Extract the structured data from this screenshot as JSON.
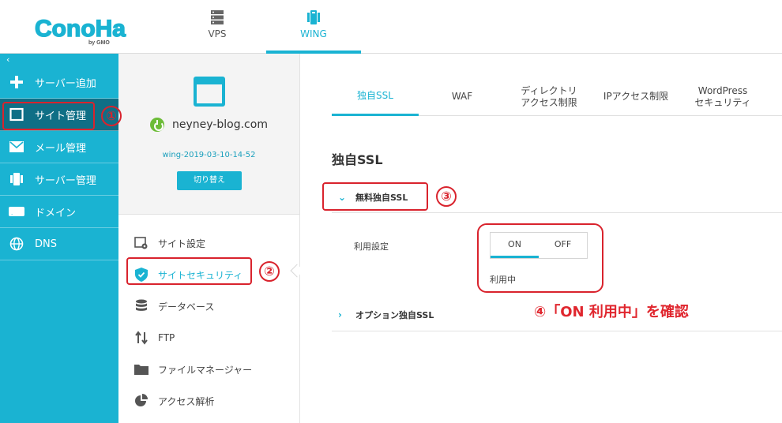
{
  "header": {
    "logo": {
      "text": "ConoHa",
      "sub": "by GMO"
    },
    "nav": [
      {
        "label": "VPS",
        "icon": "server-icon"
      },
      {
        "label": "WING",
        "icon": "wing-icon"
      }
    ]
  },
  "sidebar": {
    "collapse_icon": "chevron-left-icon",
    "items": [
      {
        "label": "サーバー追加",
        "icon": "plus-icon"
      },
      {
        "label": "サイト管理",
        "icon": "window-icon"
      },
      {
        "label": "メール管理",
        "icon": "mail-icon"
      },
      {
        "label": "サーバー管理",
        "icon": "server-manage-icon"
      },
      {
        "label": "ドメイン",
        "icon": "domain-icon"
      },
      {
        "label": "DNS",
        "icon": "globe-icon"
      }
    ]
  },
  "site": {
    "domain": "neyney-blog.com",
    "server_id": "wing-2019-03-10-14-52",
    "switch_label": "切り替え"
  },
  "site_menu": [
    {
      "label": "サイト設定",
      "icon": "site-settings-icon"
    },
    {
      "label": "サイトセキュリティ",
      "icon": "shield-icon"
    },
    {
      "label": "データベース",
      "icon": "database-icon"
    },
    {
      "label": "FTP",
      "icon": "transfer-icon"
    },
    {
      "label": "ファイルマネージャー",
      "icon": "folder-icon"
    },
    {
      "label": "アクセス解析",
      "icon": "pie-chart-icon"
    }
  ],
  "main": {
    "tabs": [
      {
        "label": "独自SSL"
      },
      {
        "label": "WAF"
      },
      {
        "label": "ディレクトリ\nアクセス制限"
      },
      {
        "label": "IPアクセス制限"
      },
      {
        "label": "WordPress\nセキュリティ"
      }
    ],
    "section_title": "独自SSL",
    "free_ssl_label": "無料独自SSL",
    "setting_label": "利用設定",
    "toggle": {
      "on": "ON",
      "off": "OFF",
      "selected": "ON"
    },
    "status": "利用中",
    "option_ssl_label": "オプション独自SSL"
  },
  "annotations": {
    "n1": "①",
    "n2": "②",
    "n3": "③",
    "note": "④「ON 利用中」を確認",
    "color": "#d9232d"
  },
  "colors": {
    "accent": "#1ab3d2",
    "sidebar_active": "#0f6f86",
    "power_on": "#6cbc37"
  }
}
